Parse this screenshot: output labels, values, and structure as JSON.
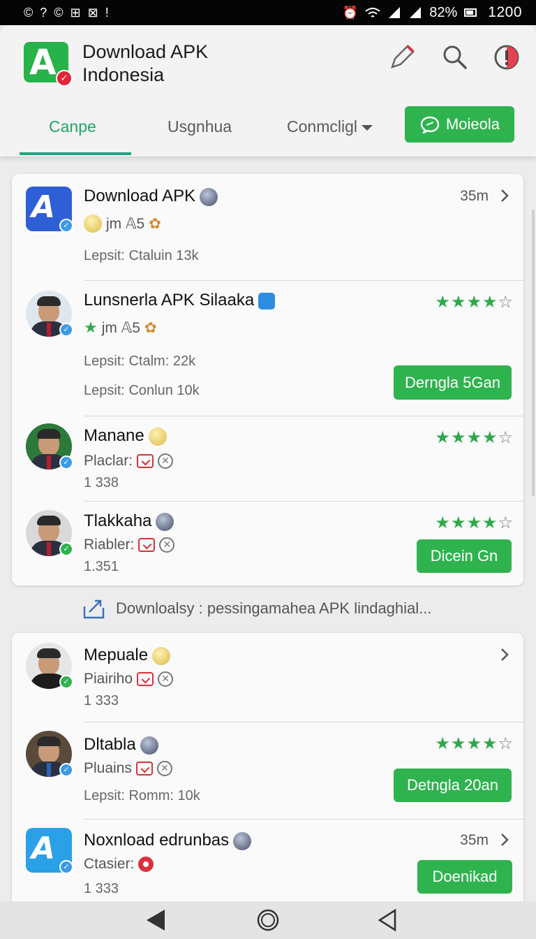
{
  "status_bar": {
    "notif_icons": [
      "©",
      "?",
      "©",
      "⊞",
      "⊠",
      "!"
    ],
    "battery": "82%",
    "time": "1200"
  },
  "header": {
    "app_title": "Download APK Indonesia",
    "logo_letter": "A",
    "tabs": [
      {
        "label": "Canpe",
        "active": true
      },
      {
        "label": "Usgnhua",
        "active": false
      },
      {
        "label": "Conmcligl",
        "active": false
      }
    ],
    "action_button": "Moieola"
  },
  "list1": [
    {
      "title": "Download APK",
      "line2": "jm 𝔸5",
      "line3": "Lepsit: Ctaluin 13k",
      "time": "35m"
    },
    {
      "title": "Lunsnerla APK Silaaka",
      "line2": "jm 𝔸5",
      "line3": "Lepsit: Ctalm: 22k",
      "line4": "Lepsit: Conlun 10k",
      "rating": "★★★★",
      "rating_empty": "☆",
      "button": "Derngla 5Gan"
    },
    {
      "title": "Manane",
      "line2": "Placlar:",
      "line3": "1 338",
      "rating": "★★★★",
      "rating_empty": "☆"
    },
    {
      "title": "Tlakkaha",
      "line2": "Riabler:",
      "line3": "1.351",
      "rating": "★★★★",
      "rating_empty": "☆",
      "button": "Dicein Gn"
    }
  ],
  "note": "Downloalsy : pessingamahea APK lindaghial...",
  "list2": [
    {
      "title": "Mepuale",
      "line2": "Piairiho",
      "line3": "1 333"
    },
    {
      "title": "Dltabla",
      "line2": "Pluains",
      "line3": "Lepsit: Romm: 10k",
      "rating": "★★★★",
      "rating_empty": "☆",
      "button": "Detngla 20an"
    },
    {
      "title": "Noxnload edrunbas",
      "line2": "Ctasier:",
      "line3": "1 333",
      "time": "35m",
      "button": "Doenikad"
    }
  ],
  "colors": {
    "accent": "#2fb34f",
    "tab_active": "#1fa66a",
    "star": "#2fa84c"
  }
}
